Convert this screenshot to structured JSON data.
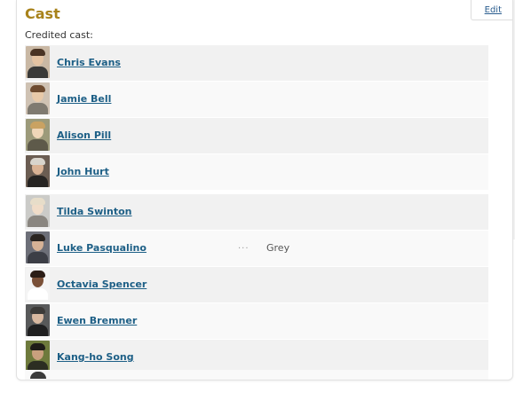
{
  "panel": {
    "title": "Cast",
    "edit_label": "Edit",
    "subtitle": "Credited cast:"
  },
  "colors": {
    "title": "#a8821a",
    "link": "#1d5f86",
    "row_odd": "#f1f1f1",
    "row_even": "#f9f9f9"
  },
  "cast": [
    {
      "name": "Chris Evans",
      "character": "",
      "ellipsis": "",
      "photo": {
        "bg": "#c9b8a4",
        "hair": "#4a3424",
        "skin": "#e4c3a2",
        "clothes": "#3a3a38"
      }
    },
    {
      "name": "Jamie Bell",
      "character": "",
      "ellipsis": "",
      "photo": {
        "bg": "#cfc2b3",
        "hair": "#6e4b2f",
        "skin": "#e8c9a8",
        "clothes": "#7f7a70"
      }
    },
    {
      "name": "Alison Pill",
      "character": "",
      "ellipsis": "",
      "photo": {
        "bg": "#9c9a7a",
        "hair": "#c9a262",
        "skin": "#efd6b8",
        "clothes": "#5e5a4a"
      }
    },
    {
      "name": "John Hurt",
      "character": "",
      "ellipsis": "",
      "photo": {
        "bg": "#6b5d52",
        "hair": "#d8d4cc",
        "skin": "#d9b294",
        "clothes": "#262422"
      }
    },
    {
      "name": "Tilda Swinton",
      "character": "",
      "ellipsis": "",
      "photo": {
        "bg": "#cbcbc8",
        "hair": "#e7ddc9",
        "skin": "#f0dcc8",
        "clothes": "#8a8680"
      }
    },
    {
      "name": "Luke Pasqualino",
      "character": "Grey",
      "ellipsis": "...",
      "photo": {
        "bg": "#6d6f78",
        "hair": "#2a2420",
        "skin": "#d6b296",
        "clothes": "#3c3e46"
      }
    },
    {
      "name": "Octavia Spencer",
      "character": "",
      "ellipsis": "",
      "photo": {
        "bg": "#f4f4f4",
        "hair": "#2b1d16",
        "skin": "#7a5038",
        "clothes": "#ffffff"
      }
    },
    {
      "name": "Ewen Bremner",
      "character": "",
      "ellipsis": "",
      "photo": {
        "bg": "#58595a",
        "hair": "#3c3a38",
        "skin": "#d8b8a0",
        "clothes": "#1f1f20"
      }
    },
    {
      "name": "Kang-ho Song",
      "character": "",
      "ellipsis": "",
      "photo": {
        "bg": "#6e7a3c",
        "hair": "#1f1c18",
        "skin": "#c9a07e",
        "clothes": "#2c2e22"
      }
    }
  ]
}
